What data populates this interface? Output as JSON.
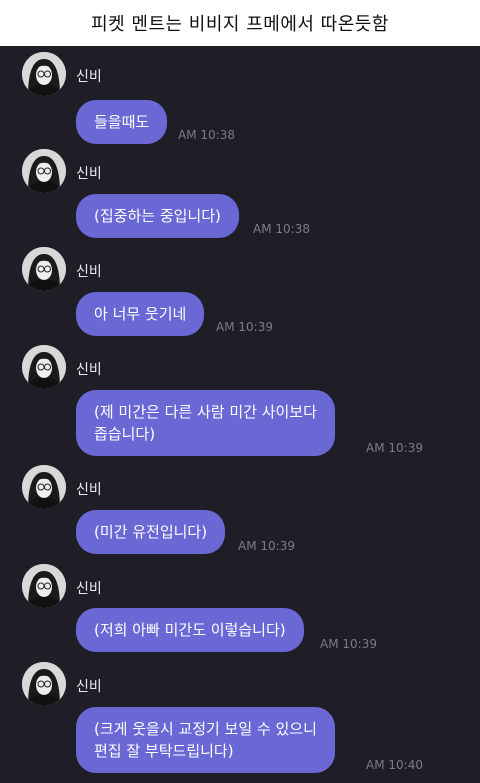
{
  "header": {
    "title": "피켓 멘트는 비비지 프메에서 따온듯함"
  },
  "messages": [
    {
      "sender": "신비",
      "text": "들을때도",
      "time": "AM 10:38"
    },
    {
      "sender": "신비",
      "text": "(집중하는 중입니다)",
      "time": "AM 10:38"
    },
    {
      "sender": "신비",
      "text": "아 너무 웃기네",
      "time": "AM 10:39"
    },
    {
      "sender": "신비",
      "text": "(제 미간은 다른 사람 미간 사이보다\n좁습니다)",
      "time": "AM 10:39"
    },
    {
      "sender": "신비",
      "text": "(미간 유전입니다)",
      "time": "AM 10:39"
    },
    {
      "sender": "신비",
      "text": "(저희 아빠 미간도 이렇습니다)",
      "time": "AM 10:39"
    },
    {
      "sender": "신비",
      "text": "(크게 웃을시 교정기 보일 수 있으니\n편집 잘 부탁드립니다)",
      "time": "AM 10:40"
    }
  ],
  "colors": {
    "background": "#1f1e26",
    "bubble": "#6a68d4",
    "time": "#7b7a86"
  },
  "icons": {
    "avatar": "profile-photo"
  }
}
